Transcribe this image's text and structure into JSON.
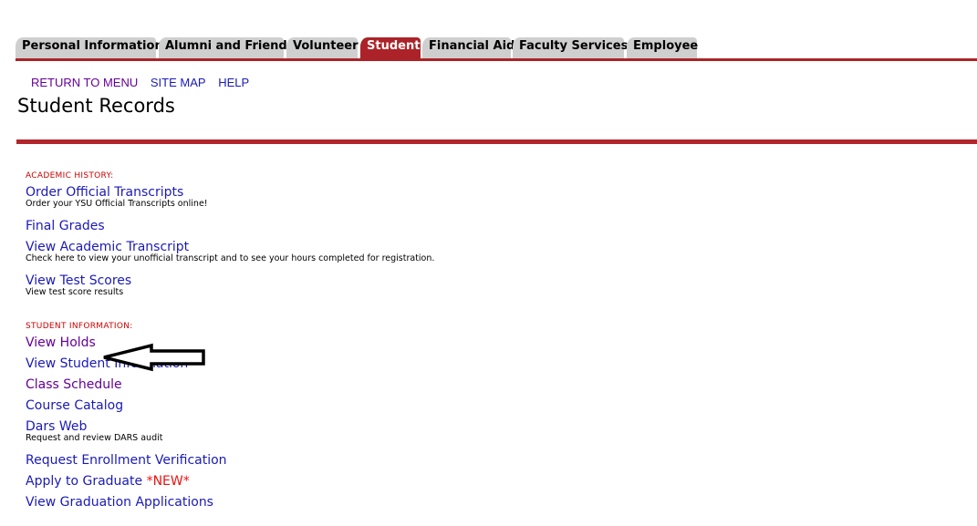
{
  "tabs": [
    {
      "label": "Personal Information",
      "active": false
    },
    {
      "label": "Alumni and Friends",
      "active": false
    },
    {
      "label": "Volunteer",
      "active": false
    },
    {
      "label": "Student",
      "active": true
    },
    {
      "label": "Financial Aid",
      "active": false
    },
    {
      "label": "Faculty Services",
      "active": false
    },
    {
      "label": "Employee",
      "active": false
    }
  ],
  "nav": {
    "return_to_menu": "RETURN TO MENU",
    "site_map": "SITE MAP",
    "help": "HELP"
  },
  "page_title": "Student Records",
  "sections": {
    "academic_history": {
      "header": "ACADEMIC HISTORY:",
      "items": [
        {
          "label": "Order Official Transcripts",
          "desc": "Order your YSU Official Transcripts online!"
        },
        {
          "label": "Final Grades"
        },
        {
          "label": "View Academic Transcript",
          "desc": "Check here to view your unofficial transcript and to see your hours completed for registration."
        },
        {
          "label": "View Test Scores",
          "desc": "View test score results"
        }
      ]
    },
    "student_information": {
      "header": "STUDENT INFORMATION:",
      "items": [
        {
          "label": "View Holds"
        },
        {
          "label": "View Student Information"
        },
        {
          "label": "Class Schedule"
        },
        {
          "label": "Course Catalog"
        },
        {
          "label": "Dars Web",
          "desc": "Request and review DARS audit"
        },
        {
          "label": "Request Enrollment Verification"
        },
        {
          "label": "Apply to Graduate",
          "badge": "*NEW*"
        },
        {
          "label": "View Graduation Applications"
        }
      ]
    }
  },
  "colors": {
    "accent": "#ab2328",
    "tab_inactive": "#cfcfcf",
    "link": "#1a1ab8",
    "visited_link": "#660099",
    "section_header": "#cc0000",
    "new_badge": "#ee1111"
  },
  "annotation": {
    "icon": "arrow-left-icon"
  }
}
